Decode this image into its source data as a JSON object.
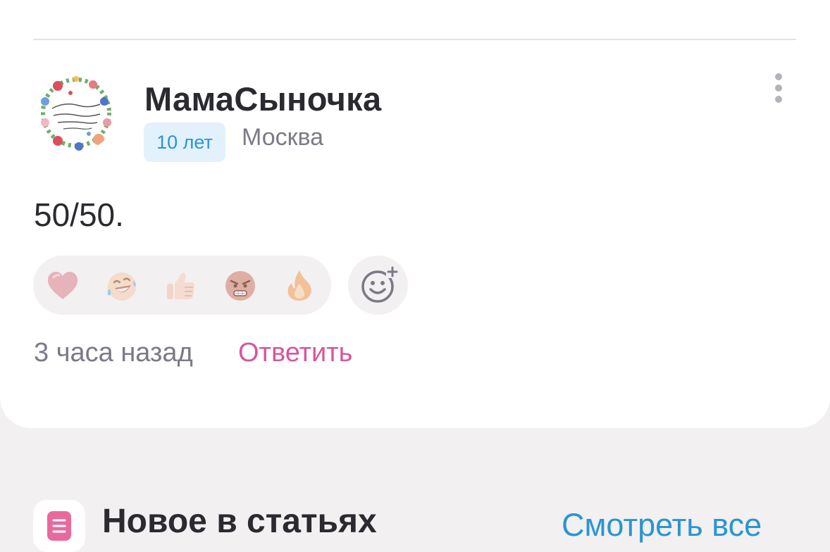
{
  "comment": {
    "author": {
      "name": "МамаСыночка",
      "age_badge": "10 лет",
      "city": "Москва",
      "avatar_icon": "floral-wreath-avatar"
    },
    "text": "50/50.",
    "reactions": [
      {
        "icon": "heart-icon"
      },
      {
        "icon": "laughing-tears-icon"
      },
      {
        "icon": "thumbs-up-icon"
      },
      {
        "icon": "angry-face-icon"
      },
      {
        "icon": "fire-icon"
      }
    ],
    "add_reaction_icon": "add-reaction-icon",
    "time": "3 часа назад",
    "reply_label": "Ответить",
    "more_icon": "more-vertical-icon"
  },
  "articles_section": {
    "title": "Новое в статьях",
    "see_all_label": "Смотреть все",
    "icon": "document-icon"
  },
  "colors": {
    "background": "#f2f0f1",
    "card": "#ffffff",
    "text_primary": "#2b2a30",
    "text_secondary": "#7c7a86",
    "badge_bg": "#e2f1fb",
    "badge_text": "#2a95d3",
    "reply_pink": "#d9559a",
    "link_blue": "#2a95d3"
  }
}
